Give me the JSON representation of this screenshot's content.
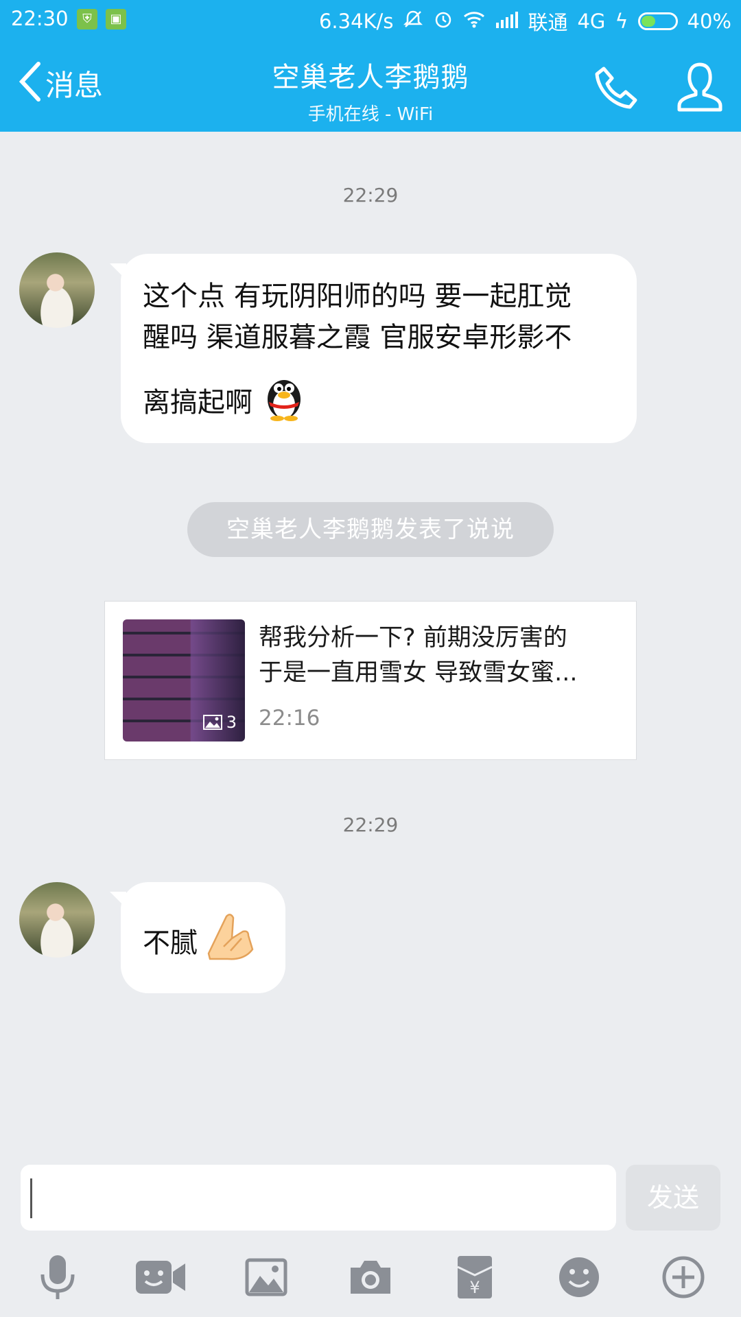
{
  "status_bar": {
    "time": "22:30",
    "net_speed": "6.34K/s",
    "carrier": "联通",
    "network": "4G",
    "battery": "40%",
    "battery_level": 0.4
  },
  "header": {
    "back_label": "消息",
    "title": "空巢老人李鹅鹅",
    "subtitle": "手机在线 - WiFi"
  },
  "chat": {
    "timestamp_1": "22:29",
    "message_1": {
      "line1": "这个点 有玩阴阳师的吗 要一起肛觉",
      "line2": "醒吗 渠道服暮之霞 官服安卓形影不",
      "line3": "离搞起啊",
      "emoji": "qq-penguin-icon"
    },
    "system_notice": "空巢老人李鹅鹅发表了说说",
    "shared_post": {
      "line1": "帮我分析一下? 前期没厉害的",
      "line2": "于是一直用雪女 导致雪女蜜...",
      "time": "22:16",
      "image_count": "3"
    },
    "timestamp_2": "22:29",
    "message_2": {
      "text": "不腻",
      "emoji": "praying-hands-icon"
    }
  },
  "composer": {
    "input_value": "",
    "send_label": "发送"
  },
  "toolbar": [
    "microphone-icon",
    "video-icon",
    "image-icon",
    "camera-icon",
    "red-packet-icon",
    "emoji-icon",
    "plus-icon"
  ],
  "colors": {
    "accent": "#1cb1ee",
    "background": "#ebedf0"
  }
}
